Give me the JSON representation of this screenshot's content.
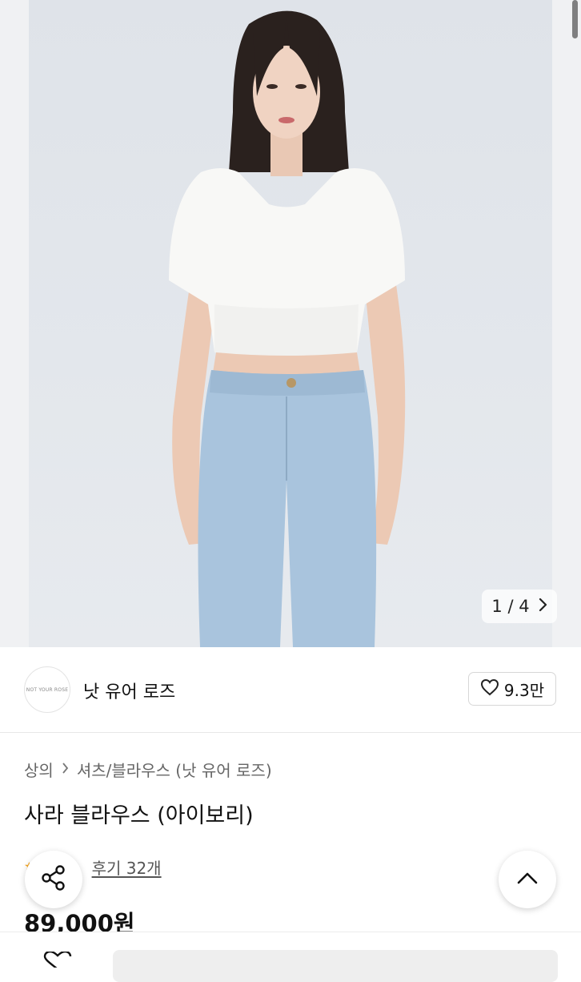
{
  "hero": {
    "pager_current": "1",
    "pager_sep": "/",
    "pager_total": "4"
  },
  "brand": {
    "name": "낫 유어 로즈",
    "logo_text": "NOT YOUR ROSE",
    "likes": "9.3만"
  },
  "breadcrumb": {
    "level1": "상의",
    "level2": "셔츠/블라우스 (낫 유어 로즈)"
  },
  "product": {
    "title": "사라 블라우스 (아이보리)",
    "reviews": "후기 32개",
    "price": "89,000원"
  }
}
